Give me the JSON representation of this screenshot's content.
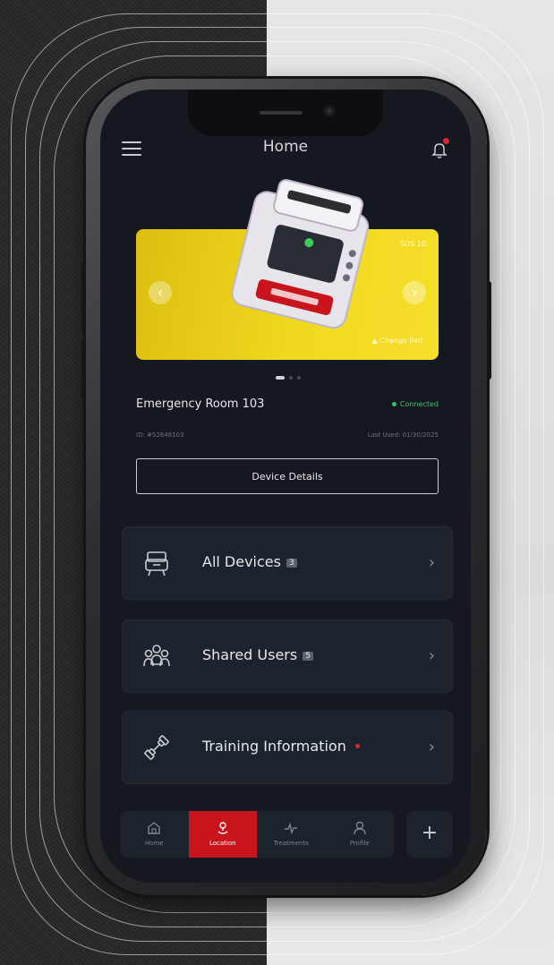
{
  "header": {
    "title": "Home"
  },
  "hero": {
    "signal_text": "SOS 10",
    "warning_text": "Change Pad",
    "accent": "#f2d820",
    "dots": 3,
    "active_dot": 0
  },
  "device": {
    "room": "Emergency Room 103",
    "status": "Connected",
    "status_color": "#38c26b",
    "id_text": "ID: #52648103",
    "last_used": "Last Used: 01/30/2025",
    "details_button": "Device Details"
  },
  "menu": [
    {
      "label": "All Devices",
      "badge": "3",
      "icon": "devices-icon"
    },
    {
      "label": "Shared Users",
      "badge": "5",
      "icon": "users-icon"
    },
    {
      "label": "Training Information",
      "badge": "",
      "icon": "dumbbell-icon",
      "notification_dot": true
    }
  ],
  "tabbar": {
    "items": [
      {
        "label": "Home",
        "icon": "home-icon"
      },
      {
        "label": "Location",
        "icon": "location-icon",
        "active": true
      },
      {
        "label": "Treatments",
        "icon": "pulse-icon"
      },
      {
        "label": "Profile",
        "icon": "profile-icon"
      }
    ],
    "fab_label": "+"
  },
  "colors": {
    "active_tab": "#c8151d",
    "alert": "#e0242e"
  }
}
